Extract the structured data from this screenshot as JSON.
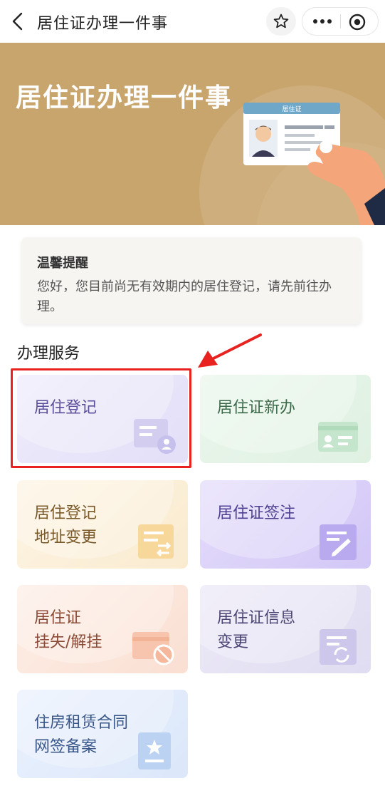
{
  "header": {
    "title": "居住证办理一件事",
    "back_icon": "chevron-left-icon",
    "favorite_icon": "star-icon",
    "more_icon": "more-dots-icon",
    "close_icon": "target-icon"
  },
  "banner": {
    "title": "居住证办理一件事",
    "card_caption": "居住证",
    "background_color": "#c9a56e"
  },
  "notice": {
    "title": "温馨提醒",
    "text": "您好，您目前尚无有效期内的居住登记，请先前往办理。"
  },
  "services": {
    "section_title": "办理服务",
    "items": [
      {
        "line1": "居住登记",
        "line2": "",
        "icon": "id-card-person-icon",
        "highlighted": true
      },
      {
        "line1": "居住证新办",
        "line2": "",
        "icon": "id-card-icon",
        "highlighted": false
      },
      {
        "line1": "居住登记",
        "line2": "地址变更",
        "icon": "swap-address-icon",
        "highlighted": false
      },
      {
        "line1": "居住证签注",
        "line2": "",
        "icon": "edit-sign-icon",
        "highlighted": false
      },
      {
        "line1": "居住证",
        "line2": "挂失/解挂",
        "icon": "card-block-icon",
        "highlighted": false
      },
      {
        "line1": "居住证信息",
        "line2": "变更",
        "icon": "refresh-doc-icon",
        "highlighted": false
      },
      {
        "line1": "住房租赁合同",
        "line2": "网签备案",
        "icon": "star-doc-icon",
        "highlighted": false
      }
    ]
  },
  "annotation": {
    "color": "#e8231f"
  }
}
